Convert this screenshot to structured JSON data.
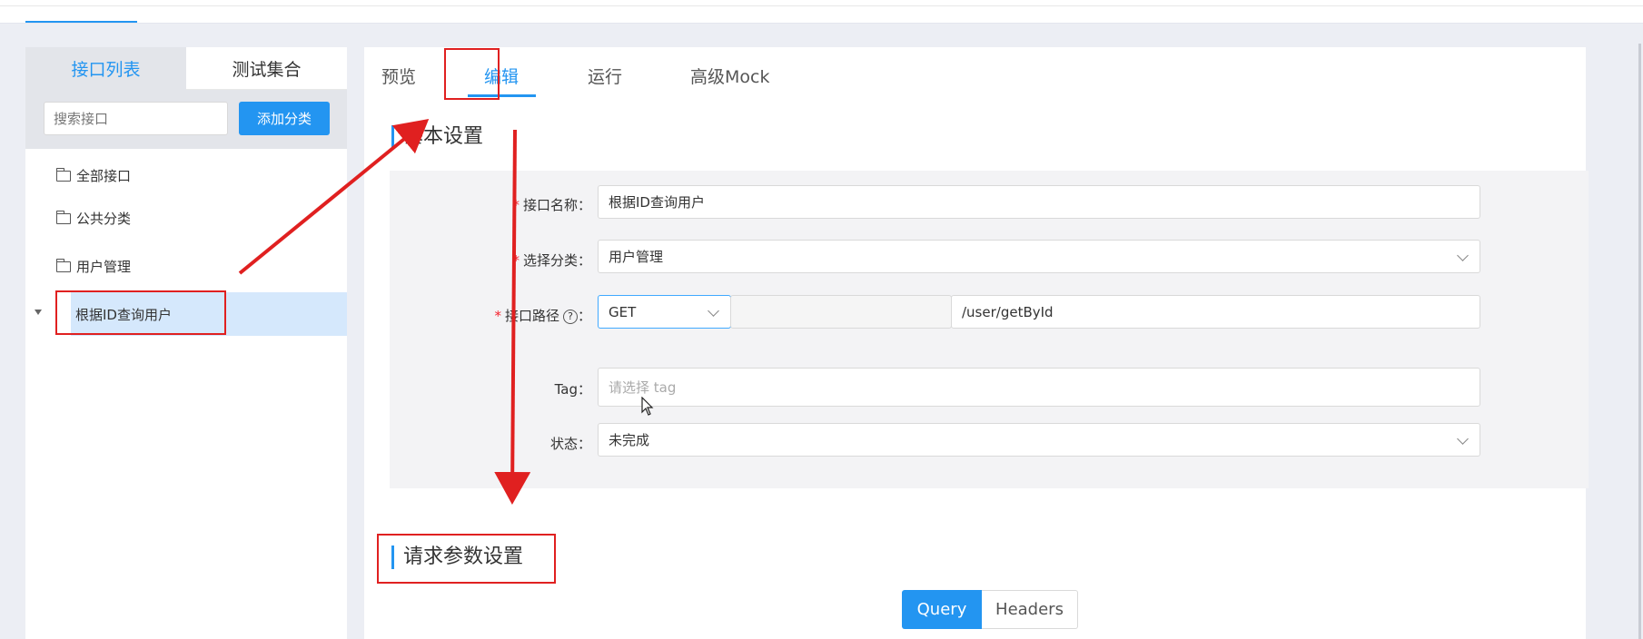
{
  "left_panel": {
    "tabs": [
      {
        "label": "接口列表",
        "active": true
      },
      {
        "label": "测试集合",
        "active": false
      }
    ],
    "search_placeholder": "搜索接口",
    "add_category_label": "添加分类",
    "tree": {
      "all": "全部接口",
      "public": "公共分类",
      "user_mgmt": "用户管理",
      "user_child": "根据ID查询用户"
    }
  },
  "right_panel": {
    "tabs": [
      {
        "label": "预览"
      },
      {
        "label": "编辑",
        "active": true
      },
      {
        "label": "运行"
      },
      {
        "label": "高级Mock"
      }
    ],
    "basic_section_title": "基本设置",
    "form": {
      "name_label": "接口名称：",
      "name_value": "根据ID查询用户",
      "category_label": "选择分类：",
      "category_value": "用户管理",
      "path_label": "接口路径",
      "path_colon": "：",
      "method_value": "GET",
      "path_value": "/user/getById",
      "tag_label": "Tag：",
      "tag_placeholder": "请选择 tag",
      "status_label": "状态：",
      "status_value": "未完成"
    },
    "request_section_title": "请求参数设置",
    "param_tabs": [
      {
        "label": "Query",
        "active": true
      },
      {
        "label": "Headers",
        "active": false
      }
    ]
  },
  "colors": {
    "accent": "#2395f1",
    "annotation_red": "#e02020",
    "required": "#f5222d"
  },
  "icons": {
    "folder": "folder-icon",
    "caret": "caret-down-icon",
    "help": "question-circle-icon",
    "chevron": "chevron-down-icon"
  }
}
